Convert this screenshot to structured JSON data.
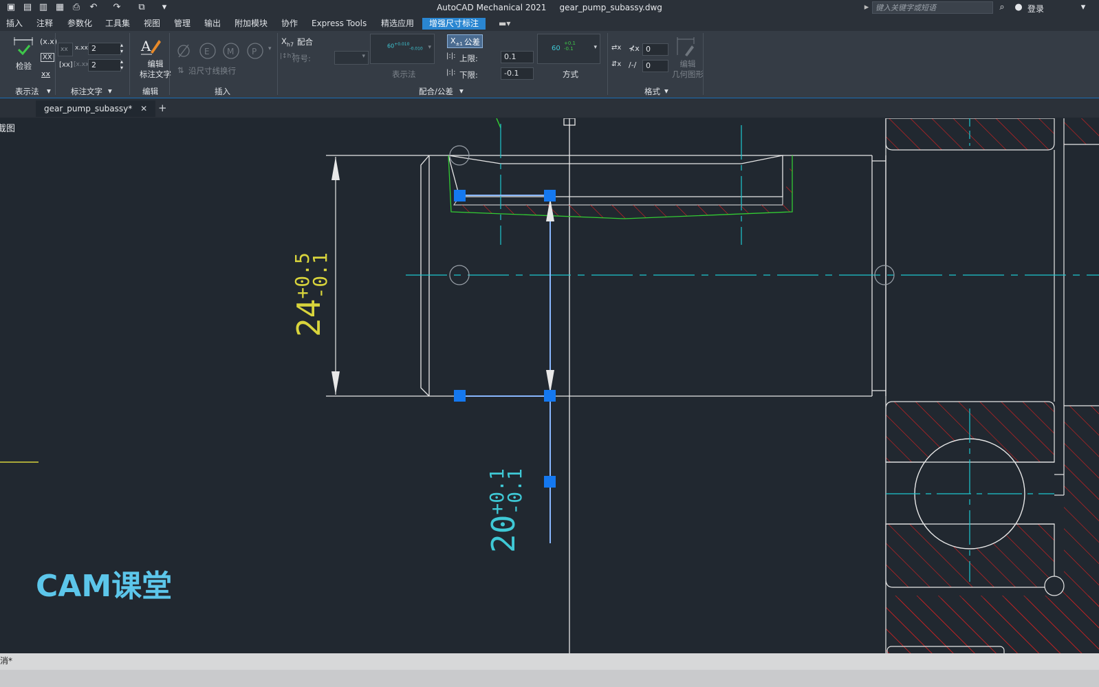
{
  "window": {
    "app_title": "AutoCAD Mechanical 2021",
    "file_title": "gear_pump_subassy.dwg",
    "search_placeholder": "键入关键字或短语",
    "login_label": "登录"
  },
  "menu_tabs": [
    "插入",
    "注释",
    "参数化",
    "工具集",
    "视图",
    "管理",
    "输出",
    "附加模块",
    "协作",
    "Express Tools",
    "精选应用",
    "增强尺寸标注"
  ],
  "active_menu_tab": "增强尺寸标注",
  "ribbon": {
    "check_label": "检验",
    "represent_panel": "表示法",
    "text_panel": "标注文字",
    "edit_panel": "编辑",
    "edit_text_label": "编辑\n标注文字",
    "insert_panel": "插入",
    "along_line_label": "沿尺寸线换行",
    "fit_label": "配合",
    "symbol_label": "符号:",
    "representation_label": "表示法",
    "fit_tolerance_panel": "配合/公差",
    "tolerance_button": "公差",
    "upper_label": "上限:",
    "upper_value": "0.1",
    "lower_label": "下限:",
    "lower_value": "-0.1",
    "method_label": "方式",
    "format_panel": "格式",
    "precision_1": "2",
    "precision_2": "2",
    "format_value_1": "0",
    "format_value_2": "0",
    "edit_geometry_label": "编辑\n几何图形",
    "preview_main": "60",
    "preview_tol": "+0.1\n-0.1"
  },
  "document_tab": {
    "name": "gear_pump_subassy*",
    "close": "✕",
    "add": "+"
  },
  "canvas": {
    "view_label": "截图",
    "dim_vertical_text": "24",
    "dim_vertical_upper": "+0.5",
    "dim_vertical_lower": "-0.1",
    "dim_cyan_text": "20",
    "dim_cyan_upper": "+0.1",
    "dim_cyan_lower": "-0.1",
    "watermark": "CAM课堂"
  },
  "command_line": {
    "text": "消*"
  },
  "colors": {
    "background": "#212830",
    "ribbon": "#353c45",
    "accent": "#2a86d1",
    "hatch": "#e02020",
    "centerline": "#1ec8d0",
    "dimension_yellow": "#d8d43c",
    "dimension_cyan": "#3fc9d6",
    "grip": "#1478f0"
  }
}
